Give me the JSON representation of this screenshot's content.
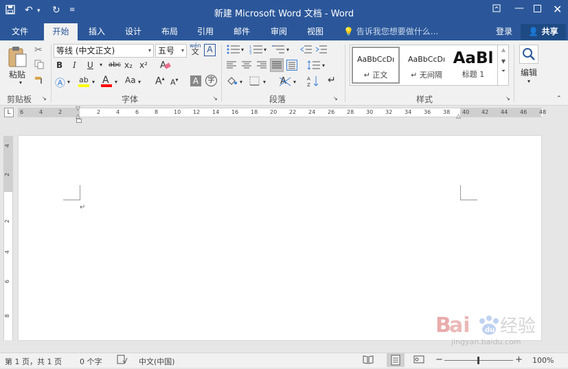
{
  "titlebar": {
    "title": "新建 Microsoft Word 文档 - Word",
    "bg": "#2b579a"
  },
  "tabs": [
    {
      "label": "文件"
    },
    {
      "label": "开始"
    },
    {
      "label": "插入"
    },
    {
      "label": "设计"
    },
    {
      "label": "布局"
    },
    {
      "label": "引用"
    },
    {
      "label": "邮件"
    },
    {
      "label": "审阅"
    },
    {
      "label": "视图"
    }
  ],
  "tell_me": "告诉我您想要做什么...",
  "account": {
    "login": "登录",
    "share": "共享"
  },
  "clipboard": {
    "paste": "粘贴",
    "label": "剪贴板"
  },
  "font": {
    "name": "等线 (中文正文)",
    "size": "五号",
    "label": "字体",
    "bold": "B",
    "italic": "I",
    "underline": "U",
    "strike": "abc",
    "sub": "x₂",
    "sup": "x²",
    "case": "Aa",
    "grow": "A",
    "shrink": "A",
    "phonetic": "wén",
    "highlight_color": "#ffff00",
    "font_color": "#ff0000"
  },
  "paragraph": {
    "label": "段落"
  },
  "styles": {
    "label": "样式",
    "items": [
      {
        "preview": "AaBbCcDı",
        "name": "↵ 正文"
      },
      {
        "preview": "AaBbCcDı",
        "name": "↵ 无间隔"
      },
      {
        "preview": "AaBl",
        "name": "标题 1"
      }
    ]
  },
  "editing": {
    "label": "编辑"
  },
  "ruler": {
    "h": [
      "6",
      "4",
      "2",
      "2",
      "4",
      "6",
      "8",
      "10",
      "12",
      "14",
      "16",
      "18",
      "20",
      "22",
      "24",
      "26",
      "28",
      "30",
      "32",
      "34",
      "36",
      "38",
      "40",
      "42",
      "44",
      "46",
      "48"
    ],
    "v": [
      "4",
      "2",
      "2",
      "4",
      "6",
      "8"
    ]
  },
  "status": {
    "page": "第 1 页，共 1 页",
    "words": "0 个字",
    "lang": "中文(中国)",
    "zoom": "100%"
  },
  "watermark": {
    "brand": "Bai",
    "brand2": "du",
    "brand_cn": "经验",
    "url": "jingyan.baidu.com"
  }
}
